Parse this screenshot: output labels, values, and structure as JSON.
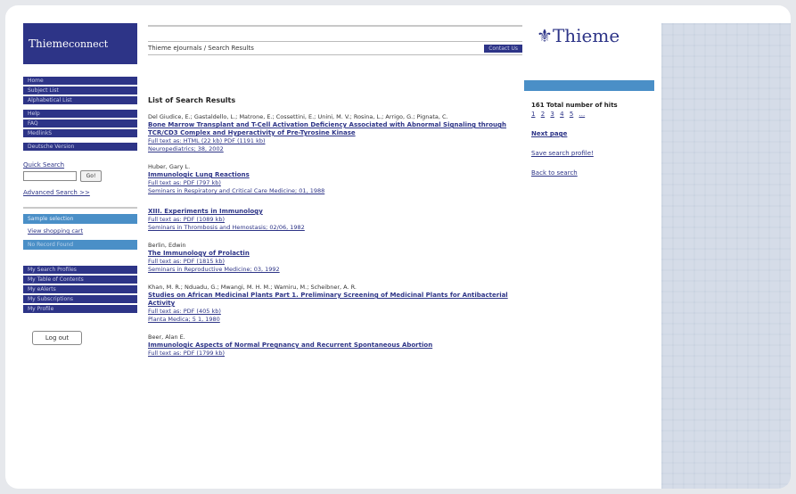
{
  "logo": {
    "text1": "Thieme",
    "text2": "connect"
  },
  "nav_top": [
    "Home",
    "Subject List",
    "Alphabetical List"
  ],
  "nav_mid": [
    "Help",
    "FAQ",
    "MedlinkS"
  ],
  "nav_lang": "Deutsche Version",
  "quick_search": {
    "label": "Quick Search",
    "go": "Go!",
    "advanced": "Advanced Search >>"
  },
  "sample_selection": "Sample selection",
  "view_cart": "View shopping cart",
  "no_record": "No Record Found",
  "nav_bottom": [
    "My Search Profiles",
    "My Table of Contents",
    "My eAlerts",
    "My Subscriptions",
    "My Profile"
  ],
  "logout": "Log out",
  "breadcrumb": {
    "text": "Thieme eJournals / Search Results",
    "contact": "Contact Us"
  },
  "heading": "List of Search Results",
  "results": [
    {
      "authors": "Del Giudice, E.; Gastaldello, L.; Matrone, E.; Cossettini, E.; Unini, M. V.; Rosina, L.; Arrigo, G.; Pignata, C.",
      "title": "Bone Marrow Transplant and T-Cell Activation Deficiency Associated with Abnormal Signaling through TCR/CD3 Complex and Hyperactivity of Pre-Tyrosine Kinase",
      "fulltext": "Full text as: HTML (22 kb) PDF (1191 kb)",
      "journal": "Neuropediatrics; 38, 2002"
    },
    {
      "authors": "Huber, Gary L.",
      "title": "Immunologic Lung Reactions",
      "fulltext": "Full text as: PDF (797 kb)",
      "journal": "Seminars in Respiratory and Critical Care Medicine; 01, 1988"
    },
    {
      "authors": "",
      "title": "XIII. Experiments in Immunology",
      "fulltext": "Full text as: PDF (1089 kb)",
      "journal": "Seminars in Thrombosis and Hemostasis; 02/06, 1982"
    },
    {
      "authors": "Berlin, Edwin",
      "title": "The Immunology of Prolactin",
      "fulltext": "Full text as: PDF (1815 kb)",
      "journal": "Seminars in Reproductive Medicine; 03, 1992"
    },
    {
      "authors": "Khan, M. R.; Nduadu, G.; Mwangi, M. H. M.; Wamiru, M.; Scheibner, A. R.",
      "title": "Studies on African Medicinal Plants Part 1. Preliminary Screening of Medicinal Plants for Antibacterial Activity",
      "fulltext": "Full text as: PDF (405 kb)",
      "journal": "Planta Medica; 5 1, 1980"
    },
    {
      "authors": "Beer, Alan E.",
      "title": "Immunologic Aspects of Normal Pregnancy and Recurrent Spontaneous Abortion",
      "fulltext": "Full text as: PDF (1799 kb)",
      "journal": ""
    }
  ],
  "right": {
    "brand": "Thieme",
    "total": "161 Total number of hits",
    "pages": [
      "1",
      "2",
      "3",
      "4",
      "5",
      "..."
    ],
    "next_page": "Next page",
    "save_profile": "Save search profile!",
    "back": "Back to search"
  }
}
